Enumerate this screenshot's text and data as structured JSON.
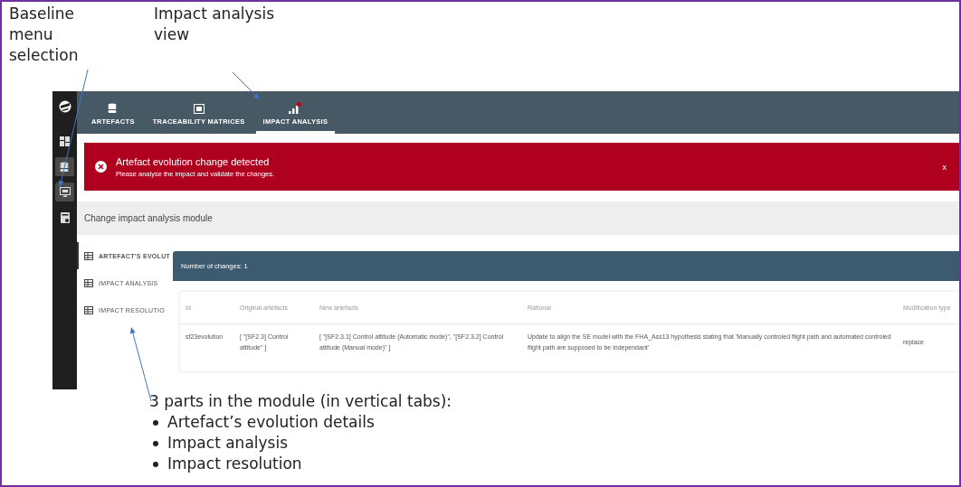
{
  "annotations": {
    "menu_selection": "Baseline menu selection",
    "view": "Impact analysis view",
    "parts_intro": "3 parts in the module (in vertical tabs):",
    "parts": [
      "Artefact’s evolution details",
      "Impact analysis",
      "Impact resolution"
    ]
  },
  "sidebar": {
    "items": [
      {
        "kind": "dashboard",
        "selected": false
      },
      {
        "kind": "database",
        "selected": true
      },
      {
        "kind": "monitor",
        "selected": true
      },
      {
        "kind": "report",
        "selected": false
      }
    ]
  },
  "top_tabs": [
    {
      "label": "ARTEFACTS",
      "kind": "database",
      "selected": false
    },
    {
      "label": "TRACEABILITY MATRICES",
      "kind": "matrix",
      "selected": false
    },
    {
      "label": "IMPACT ANALYSIS",
      "kind": "chart",
      "selected": true
    }
  ],
  "alert": {
    "title": "Artefact evolution change detected",
    "message": "Please analyse the impact and validate the changes.",
    "close": "x"
  },
  "module_title": "Change impact analysis module",
  "vertical_tabs": [
    {
      "label": "ARTEFACT'S EVOLUT",
      "selected": true
    },
    {
      "label": "IMPACT ANALYSIS",
      "selected": false
    },
    {
      "label": "IMPACT RESOLUTIO",
      "selected": false
    }
  ],
  "changes_bar": "Number of changes: 1",
  "table": {
    "columns": [
      "Id",
      "Original artefacts",
      "New artefacts",
      "Rational",
      "Modification type"
    ],
    "rows": [
      [
        "sf23evolution",
        "[ \"[SF2.3] Control attitude\" ]",
        "[ \"[SF2.3.1] Control attitude (Automatic mode)\", \"[SF2.3.2] Control attitude (Manual mode)\" ]",
        "Update to align the SE model with the FHA_Ass13 hypothesis stating that 'Manually controled flight path and automated controled flight path are supposed to be independant'",
        "replace"
      ]
    ]
  }
}
